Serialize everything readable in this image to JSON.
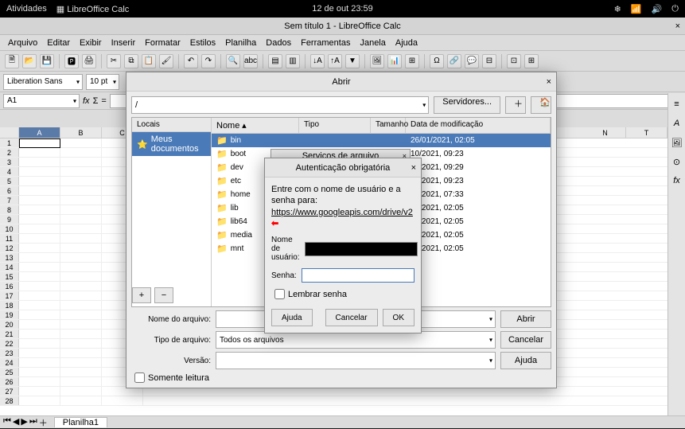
{
  "topbar": {
    "activities": "Atividades",
    "app": "LibreOffice Calc",
    "datetime": "12 de out  23:59"
  },
  "window": {
    "title": "Sem título 1 - LibreOffice Calc",
    "close": "×"
  },
  "menubar": [
    "Arquivo",
    "Editar",
    "Exibir",
    "Inserir",
    "Formatar",
    "Estilos",
    "Planilha",
    "Dados",
    "Ferramentas",
    "Janela",
    "Ajuda"
  ],
  "formatbar": {
    "font": "Liberation Sans",
    "size": "10 pt"
  },
  "cellbar": {
    "cell": "A1",
    "fx": "fx",
    "sigma": "Σ",
    "eq": "="
  },
  "columns": [
    "A",
    "B",
    "C",
    "N",
    "T"
  ],
  "rows": [
    "1",
    "2",
    "3",
    "4",
    "5",
    "6",
    "7",
    "8",
    "9",
    "10",
    "11",
    "12",
    "13",
    "14",
    "15",
    "16",
    "17",
    "18",
    "19",
    "20",
    "21",
    "22",
    "23",
    "24",
    "25",
    "26",
    "27",
    "28"
  ],
  "sheet_tab": "Planilha1",
  "open_dialog": {
    "title": "Abrir",
    "path": "/",
    "servers_btn": "Servidores...",
    "places_header": "Locais",
    "places": [
      {
        "icon": "⭐",
        "label": "Meus documentos",
        "selected": true
      }
    ],
    "cols": {
      "name": "Nome",
      "type": "Tipo",
      "size": "Tamanho",
      "date": "Data de modificação"
    },
    "files": [
      {
        "name": "bin",
        "date": "26/01/2021, 02:05",
        "sel": true
      },
      {
        "name": "boot",
        "date": "10/2021, 09:23"
      },
      {
        "name": "dev",
        "date": "10/2021, 09:29"
      },
      {
        "name": "etc",
        "date": "10/2021, 09:23"
      },
      {
        "name": "home",
        "date": "10/2021, 07:33"
      },
      {
        "name": "lib",
        "date": "01/2021, 02:05"
      },
      {
        "name": "lib64",
        "date": "01/2021, 02:05"
      },
      {
        "name": "media",
        "date": "01/2021, 02:05"
      },
      {
        "name": "mnt",
        "date": "01/2021, 02:05"
      }
    ],
    "add": "+",
    "remove": "−",
    "filename_label": "Nome do arquivo:",
    "filename_value": "",
    "open_btn": "Abrir",
    "filetype_label": "Tipo de arquivo:",
    "filetype_value": "Todos os arquivos",
    "cancel_btn": "Cancelar",
    "version_label": "Versão:",
    "version_value": "",
    "help_btn": "Ajuda",
    "readonly": "Somente leitura"
  },
  "servicos_dialog": {
    "title": "Serviços de arquivo",
    "close": "×"
  },
  "auth_dialog": {
    "title": "Autenticação obrigatória",
    "close": "×",
    "msg_prefix": "Entre com o nome de usuário e a senha para:",
    "msg_url": "https://www.googleapis.com/drive/v2",
    "user_label": "Nome de usuário:",
    "pass_label": "Senha:",
    "remember": "Lembrar senha",
    "help": "Ajuda",
    "cancel": "Cancelar",
    "ok": "OK"
  }
}
